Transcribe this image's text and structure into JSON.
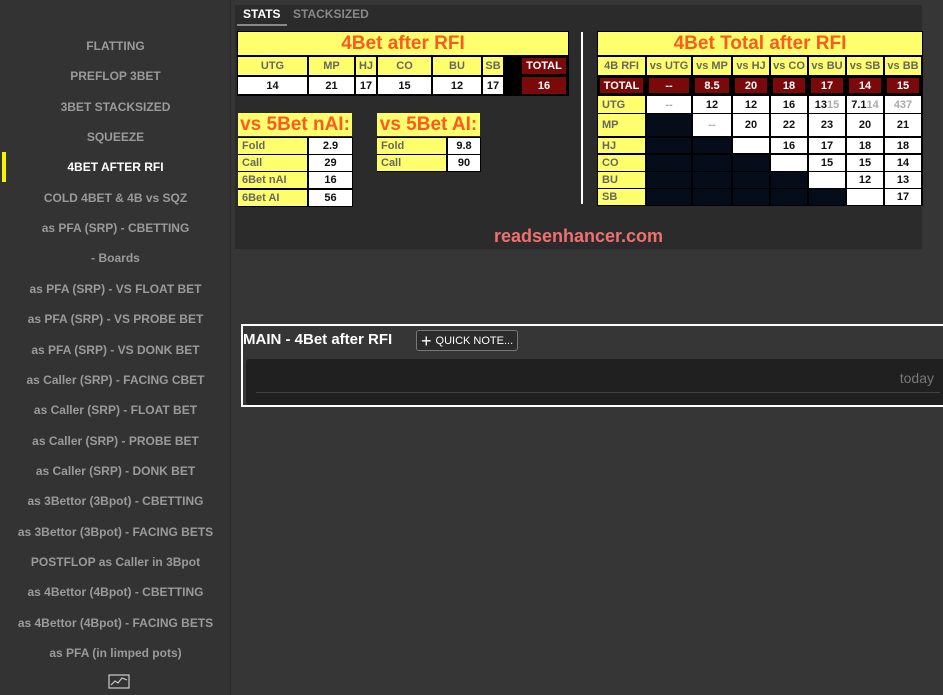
{
  "sidebar": {
    "items": [
      "FLATTING",
      "PREFLOP 3BET",
      "3BET STACKSIZED",
      "SQUEEZE",
      "4BET AFTER RFI",
      "COLD 4BET & 4B vs SQZ",
      "as PFA (SRP) - CBETTING",
      "- Boards",
      "as PFA (SRP) - VS FLOAT BET",
      "as PFA (SRP) - VS PROBE BET",
      "as PFA (SRP) - VS DONK BET",
      "as Caller (SRP) - FACING CBET",
      "as Caller (SRP) - FLOAT BET",
      "as Caller (SRP) - PROBE BET",
      "as Caller (SRP) - DONK BET",
      "as 3Bettor (3Bpot) - CBETTING",
      "as 3Bettor (3Bpot) - FACING BETS",
      "POSTFLOP as Caller in 3Bpot",
      "as 4Bettor (4Bpot) - CBETTING",
      "as 4Bettor (4Bpot) - FACING BETS",
      "as PFA (in limped pots)"
    ],
    "active_index": 4,
    "bottom_icon": "chart-line-icon"
  },
  "tabs": [
    "STATS",
    "STACKSIZED"
  ],
  "left_table": {
    "title": "4Bet after RFI",
    "headers": [
      "UTG",
      "MP",
      "HJ",
      "CO",
      "BU",
      "SB"
    ],
    "values": [
      "14",
      "21",
      "17",
      "15",
      "12",
      "17"
    ],
    "total_label": "TOTAL",
    "total_value": "16"
  },
  "nai": {
    "title": "vs 5Bet nAI:",
    "rows": [
      [
        "Fold",
        "2.9"
      ],
      [
        "Call",
        "29"
      ],
      [
        "6Bet nAI",
        "16"
      ],
      [
        "6Bet AI",
        "56"
      ]
    ]
  },
  "ai": {
    "title": "vs 5Bet AI:",
    "rows": [
      [
        "Fold",
        "9.8"
      ],
      [
        "Call",
        "90"
      ]
    ]
  },
  "right_table": {
    "title": "4Bet Total after RFI",
    "headers": [
      "4B RFI",
      "vs UTG",
      "vs MP",
      "vs HJ",
      "vs CO",
      "vs BU",
      "vs SB",
      "vs BB"
    ],
    "total_row": [
      "TOTAL",
      "--",
      "8.5",
      "20",
      "18",
      "17",
      "14",
      "15"
    ],
    "rows": [
      {
        "label": "UTG",
        "cells": [
          "--",
          "12",
          "12",
          "16",
          "13",
          "7.1",
          ""
        ],
        "ghost": [
          "",
          "",
          "",
          "",
          "15",
          "14",
          "437"
        ]
      },
      {
        "label": "MP",
        "cells": [
          "",
          "--",
          "20",
          "22",
          "23",
          "20",
          "21"
        ]
      },
      {
        "label": "HJ",
        "cells": [
          "",
          "",
          "",
          "16",
          "17",
          "18",
          "18"
        ]
      },
      {
        "label": "CO",
        "cells": [
          "",
          "",
          "",
          "",
          "15",
          "15",
          "14"
        ]
      },
      {
        "label": "BU",
        "cells": [
          "",
          "",
          "",
          "",
          "",
          "12",
          "13"
        ]
      },
      {
        "label": "SB",
        "cells": [
          "",
          "",
          "",
          "",
          "",
          "",
          "17"
        ]
      }
    ]
  },
  "brand": "readsenhancer.com",
  "notes": {
    "title": "MAIN - 4Bet after RFI",
    "quick_note": "QUICK NOTE...",
    "date": "today"
  },
  "colors": {
    "accent_yellow": "#ffff6e",
    "title_orange": "#ff5a1e",
    "total_red": "#7a0a0a",
    "active_marker": "#f5f500"
  }
}
